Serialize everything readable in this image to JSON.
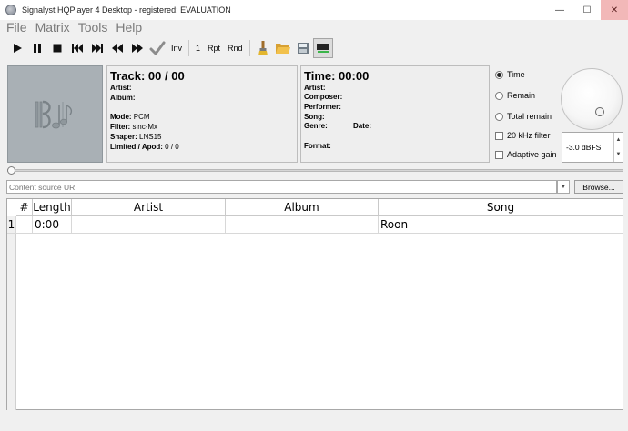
{
  "window": {
    "title": "Signalyst HQPlayer 4 Desktop - registered: EVALUATION",
    "controls": {
      "minimize": "—",
      "maximize": "☐",
      "close": "✕"
    }
  },
  "menu": [
    "File",
    "Matrix",
    "Tools",
    "Help"
  ],
  "toolbar": {
    "icons": [
      "play-icon",
      "pause-icon",
      "stop-icon",
      "previous-track-icon",
      "next-track-icon",
      "rewind-icon",
      "fast-forward-icon",
      "checkmark-icon",
      "brush-icon",
      "folder-open-icon",
      "save-icon",
      "display-icon"
    ],
    "inv_label": "Inv",
    "one_label": "1",
    "rpt_label": "Rpt",
    "rnd_label": "Rnd"
  },
  "track_info": {
    "heading": "Track: 00 / 00",
    "artist_label": "Artist:",
    "album_label": "Album:",
    "mode_label": "Mode:",
    "mode_value": "PCM",
    "filter_label": "Filter:",
    "filter_value": "sinc-Mx",
    "shaper_label": "Shaper:",
    "shaper_value": "LNS15",
    "limited_label": "Limited / Apod:",
    "limited_value": "0 / 0"
  },
  "time_info": {
    "heading": "Time: 00:00",
    "artist_label": "Artist:",
    "composer_label": "Composer:",
    "performer_label": "Performer:",
    "song_label": "Song:",
    "genre_label": "Genre:",
    "date_label": "Date:",
    "format_label": "Format:"
  },
  "display_options": {
    "time_label": "Time",
    "remain_label": "Remain",
    "total_remain_label": "Total remain",
    "selected": "Time",
    "filter_20khz_label": "20 kHz filter",
    "adaptive_gain_label": "Adaptive gain"
  },
  "volume": {
    "value_label": "-3.0 dBFS"
  },
  "seek": {
    "position": 0
  },
  "uri": {
    "placeholder": "Content source URI"
  },
  "browse_label": "Browse...",
  "colors": {
    "close_button": "#f2b8b8",
    "album_art_bg": "#a9b0b5"
  },
  "playlist": {
    "headers": [
      "#",
      "Length",
      "Artist",
      "Album",
      "Song"
    ],
    "rows": [
      {
        "num": "1",
        "length": "0:00",
        "artist": "",
        "album": "",
        "song": "Roon"
      }
    ]
  }
}
